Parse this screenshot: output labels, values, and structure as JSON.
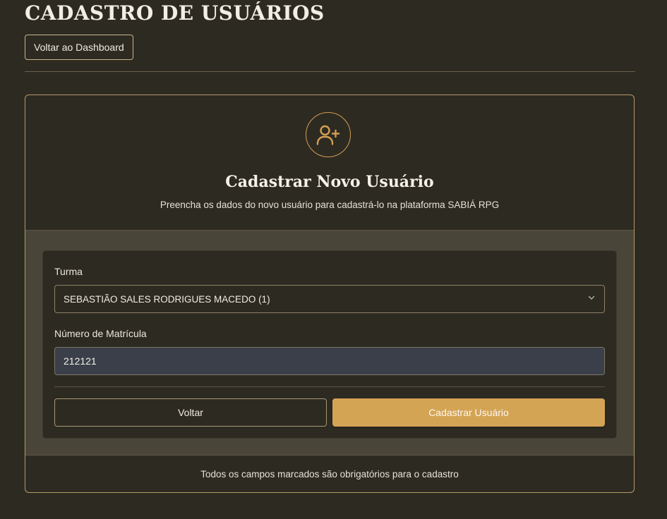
{
  "header": {
    "title": "CADASTRO DE USUÁRIOS",
    "back_button": "Voltar ao Dashboard"
  },
  "card": {
    "icon": "user-plus-icon",
    "title": "Cadastrar Novo Usuário",
    "subtitle": "Preencha os dados do novo usuário para cadastrá-lo na plataforma SABIÁ RPG",
    "footer_note": "Todos os campos marcados são obrigatórios para o cadastro"
  },
  "form": {
    "turma": {
      "label": "Turma",
      "selected": "SEBASTIÃO SALES RODRIGUES MACEDO (1)"
    },
    "matricula": {
      "label": "Número de Matrícula",
      "value": "212121"
    },
    "back_button": "Voltar",
    "submit_button": "Cadastrar Usuário"
  },
  "colors": {
    "background": "#2d2a22",
    "accent": "#d4a455",
    "panel": "#4a4539",
    "input_fill": "#3a3f49"
  }
}
